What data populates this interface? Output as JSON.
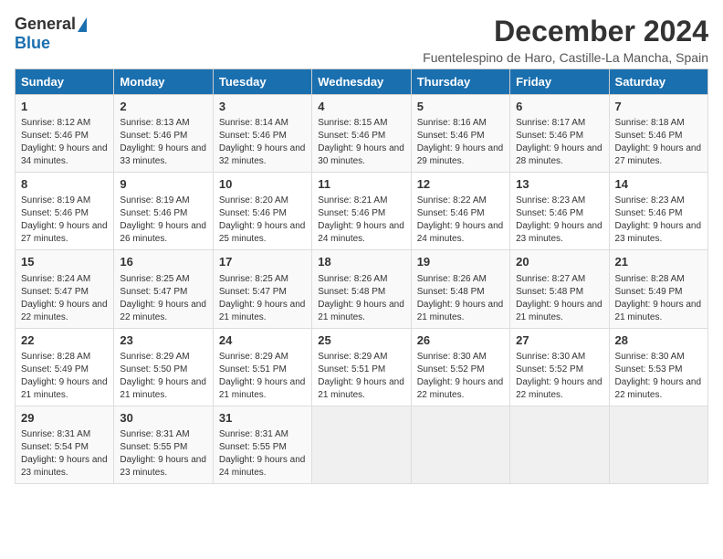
{
  "logo": {
    "general": "General",
    "blue": "Blue"
  },
  "title": "December 2024",
  "subtitle": "Fuentelespino de Haro, Castille-La Mancha, Spain",
  "headers": [
    "Sunday",
    "Monday",
    "Tuesday",
    "Wednesday",
    "Thursday",
    "Friday",
    "Saturday"
  ],
  "weeks": [
    [
      {
        "day": "1",
        "sunrise": "8:12 AM",
        "sunset": "5:46 PM",
        "daylight": "9 hours and 34 minutes."
      },
      {
        "day": "2",
        "sunrise": "8:13 AM",
        "sunset": "5:46 PM",
        "daylight": "9 hours and 33 minutes."
      },
      {
        "day": "3",
        "sunrise": "8:14 AM",
        "sunset": "5:46 PM",
        "daylight": "9 hours and 32 minutes."
      },
      {
        "day": "4",
        "sunrise": "8:15 AM",
        "sunset": "5:46 PM",
        "daylight": "9 hours and 30 minutes."
      },
      {
        "day": "5",
        "sunrise": "8:16 AM",
        "sunset": "5:46 PM",
        "daylight": "9 hours and 29 minutes."
      },
      {
        "day": "6",
        "sunrise": "8:17 AM",
        "sunset": "5:46 PM",
        "daylight": "9 hours and 28 minutes."
      },
      {
        "day": "7",
        "sunrise": "8:18 AM",
        "sunset": "5:46 PM",
        "daylight": "9 hours and 27 minutes."
      }
    ],
    [
      {
        "day": "8",
        "sunrise": "8:19 AM",
        "sunset": "5:46 PM",
        "daylight": "9 hours and 27 minutes."
      },
      {
        "day": "9",
        "sunrise": "8:19 AM",
        "sunset": "5:46 PM",
        "daylight": "9 hours and 26 minutes."
      },
      {
        "day": "10",
        "sunrise": "8:20 AM",
        "sunset": "5:46 PM",
        "daylight": "9 hours and 25 minutes."
      },
      {
        "day": "11",
        "sunrise": "8:21 AM",
        "sunset": "5:46 PM",
        "daylight": "9 hours and 24 minutes."
      },
      {
        "day": "12",
        "sunrise": "8:22 AM",
        "sunset": "5:46 PM",
        "daylight": "9 hours and 24 minutes."
      },
      {
        "day": "13",
        "sunrise": "8:23 AM",
        "sunset": "5:46 PM",
        "daylight": "9 hours and 23 minutes."
      },
      {
        "day": "14",
        "sunrise": "8:23 AM",
        "sunset": "5:46 PM",
        "daylight": "9 hours and 23 minutes."
      }
    ],
    [
      {
        "day": "15",
        "sunrise": "8:24 AM",
        "sunset": "5:47 PM",
        "daylight": "9 hours and 22 minutes."
      },
      {
        "day": "16",
        "sunrise": "8:25 AM",
        "sunset": "5:47 PM",
        "daylight": "9 hours and 22 minutes."
      },
      {
        "day": "17",
        "sunrise": "8:25 AM",
        "sunset": "5:47 PM",
        "daylight": "9 hours and 21 minutes."
      },
      {
        "day": "18",
        "sunrise": "8:26 AM",
        "sunset": "5:48 PM",
        "daylight": "9 hours and 21 minutes."
      },
      {
        "day": "19",
        "sunrise": "8:26 AM",
        "sunset": "5:48 PM",
        "daylight": "9 hours and 21 minutes."
      },
      {
        "day": "20",
        "sunrise": "8:27 AM",
        "sunset": "5:48 PM",
        "daylight": "9 hours and 21 minutes."
      },
      {
        "day": "21",
        "sunrise": "8:28 AM",
        "sunset": "5:49 PM",
        "daylight": "9 hours and 21 minutes."
      }
    ],
    [
      {
        "day": "22",
        "sunrise": "8:28 AM",
        "sunset": "5:49 PM",
        "daylight": "9 hours and 21 minutes."
      },
      {
        "day": "23",
        "sunrise": "8:29 AM",
        "sunset": "5:50 PM",
        "daylight": "9 hours and 21 minutes."
      },
      {
        "day": "24",
        "sunrise": "8:29 AM",
        "sunset": "5:51 PM",
        "daylight": "9 hours and 21 minutes."
      },
      {
        "day": "25",
        "sunrise": "8:29 AM",
        "sunset": "5:51 PM",
        "daylight": "9 hours and 21 minutes."
      },
      {
        "day": "26",
        "sunrise": "8:30 AM",
        "sunset": "5:52 PM",
        "daylight": "9 hours and 22 minutes."
      },
      {
        "day": "27",
        "sunrise": "8:30 AM",
        "sunset": "5:52 PM",
        "daylight": "9 hours and 22 minutes."
      },
      {
        "day": "28",
        "sunrise": "8:30 AM",
        "sunset": "5:53 PM",
        "daylight": "9 hours and 22 minutes."
      }
    ],
    [
      {
        "day": "29",
        "sunrise": "8:31 AM",
        "sunset": "5:54 PM",
        "daylight": "9 hours and 23 minutes."
      },
      {
        "day": "30",
        "sunrise": "8:31 AM",
        "sunset": "5:55 PM",
        "daylight": "9 hours and 23 minutes."
      },
      {
        "day": "31",
        "sunrise": "8:31 AM",
        "sunset": "5:55 PM",
        "daylight": "9 hours and 24 minutes."
      },
      null,
      null,
      null,
      null
    ]
  ],
  "labels": {
    "sunrise": "Sunrise:",
    "sunset": "Sunset:",
    "daylight": "Daylight:"
  }
}
